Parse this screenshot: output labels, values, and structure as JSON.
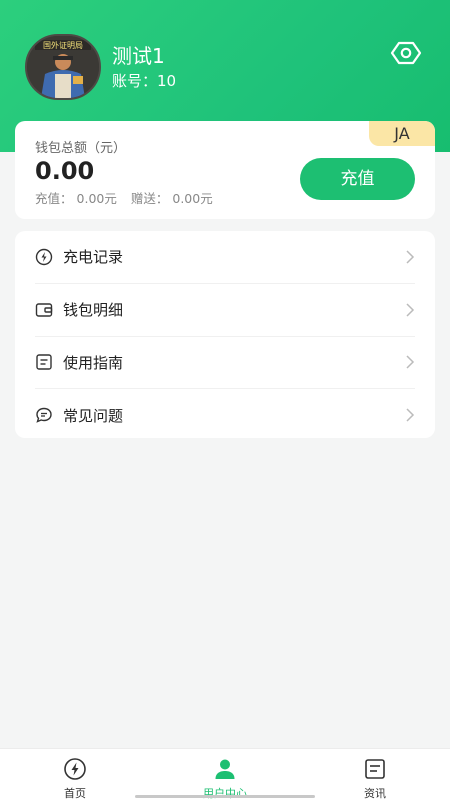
{
  "colors": {
    "accent": "#1dbf72",
    "header_gradient_start": "#2ccf7d",
    "badge": "#fbe6a6",
    "background": "#f4f5f5"
  },
  "profile": {
    "name": "测试1",
    "account": "账号：10",
    "avatar_text": "国外证明局",
    "eye_icon": "eye-icon"
  },
  "wallet": {
    "badge": "JA",
    "label": "钱包总额（元）",
    "amount": "0.00",
    "recharge_label": "充值：",
    "recharge_value": "0.00元",
    "gift_label": "赠送：",
    "gift_value": "0.00元",
    "button": "充值"
  },
  "menu": {
    "items": [
      {
        "label": "充电记录",
        "icon": "lightning-icon"
      },
      {
        "label": "钱包明细",
        "icon": "wallet-icon"
      },
      {
        "label": "使用指南",
        "icon": "guide-icon"
      },
      {
        "label": "常见问题",
        "icon": "chat-icon"
      }
    ]
  },
  "tabbar": {
    "tabs": [
      {
        "label": "首页",
        "icon": "lightning-circle-icon",
        "active": false
      },
      {
        "label": "用户中心",
        "icon": "user-icon",
        "active": true
      },
      {
        "label": "资讯",
        "icon": "news-icon",
        "active": false
      }
    ]
  }
}
